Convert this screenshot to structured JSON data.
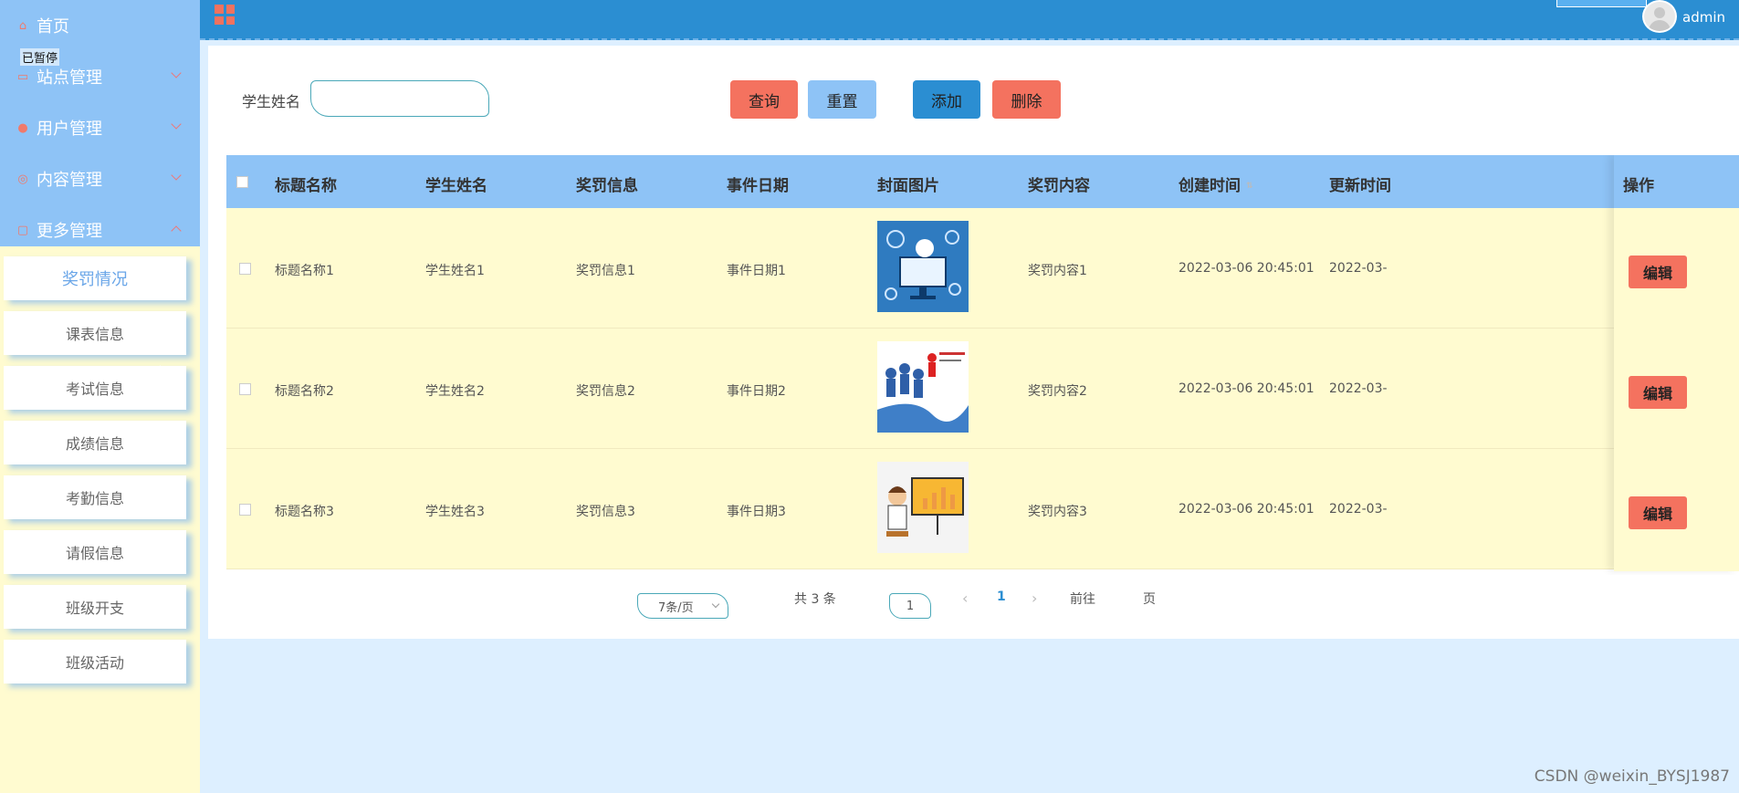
{
  "sidebar": {
    "menu": [
      {
        "label": "首页",
        "icon": "home-icon"
      },
      {
        "label": "站点管理",
        "icon": "site-icon"
      },
      {
        "label": "用户管理",
        "icon": "user-icon"
      },
      {
        "label": "内容管理",
        "icon": "content-icon"
      },
      {
        "label": "更多管理",
        "icon": "more-icon"
      }
    ],
    "paused_label": "已暂停",
    "sub_items": [
      "奖罚情况",
      "课表信息",
      "考试信息",
      "成绩信息",
      "考勤信息",
      "请假信息",
      "班级开支",
      "班级活动"
    ]
  },
  "header": {
    "username": "admin"
  },
  "search": {
    "label": "学生姓名",
    "placeholder": ""
  },
  "buttons": {
    "query": "查询",
    "reset": "重置",
    "add": "添加",
    "delete": "删除"
  },
  "table": {
    "headers": [
      "标题名称",
      "学生姓名",
      "奖罚信息",
      "事件日期",
      "封面图片",
      "奖罚内容",
      "创建时间",
      "更新时间",
      "操作"
    ],
    "rows": [
      {
        "title": "标题名称1",
        "student": "学生姓名1",
        "info": "奖罚信息1",
        "date": "事件日期1",
        "content": "奖罚内容1",
        "created": "2022-03-06 20:45:01",
        "updated": "2022-03-",
        "image_label": "robot-cover"
      },
      {
        "title": "标题名称2",
        "student": "学生姓名2",
        "info": "奖罚信息2",
        "date": "事件日期2",
        "content": "奖罚内容2",
        "created": "2022-03-06 20:45:01",
        "updated": "2022-03-",
        "image_label": "team-cover"
      },
      {
        "title": "标题名称3",
        "student": "学生姓名3",
        "info": "奖罚信息3",
        "date": "事件日期3",
        "content": "奖罚内容3",
        "created": "2022-03-06 20:45:01",
        "updated": "2022-03-",
        "image_label": "teacher-cover"
      }
    ],
    "edit_label": "编辑"
  },
  "pagination": {
    "total": "共 3 条",
    "page_size": "7条/页",
    "current_page": "1",
    "goto_prefix": "前往",
    "goto_value": "1",
    "goto_suffix": "页",
    "prev": "‹",
    "next": "›"
  },
  "watermark": "CSDN @weixin_BYSJ1987",
  "colors": {
    "header": "#2b8ed2",
    "sidebar_top": "#8ec3f6",
    "accent_red": "#f4725f",
    "row_bg": "#fffbd0"
  }
}
